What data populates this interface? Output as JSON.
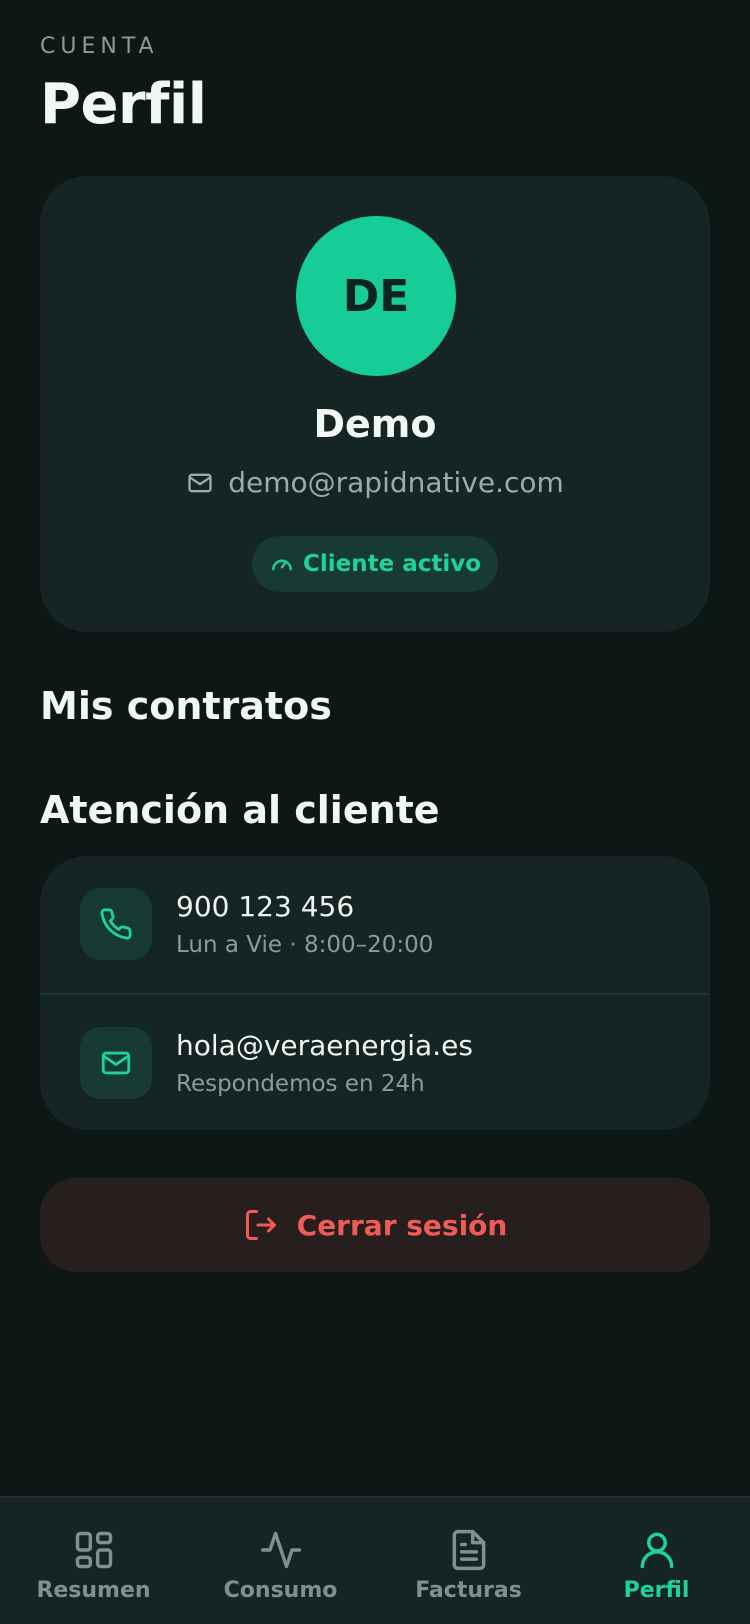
{
  "header": {
    "eyebrow": "CUENTA",
    "title": "Perfil"
  },
  "profile": {
    "initials": "DE",
    "name": "Demo",
    "email": "demo@rapidnative.com",
    "status": "Cliente activo"
  },
  "sections": {
    "contracts_title": "Mis contratos",
    "support_title": "Atención al cliente"
  },
  "support": [
    {
      "icon": "phone-icon",
      "primary": "900 123 456",
      "secondary": "Lun a Vie · 8:00–20:00"
    },
    {
      "icon": "mail-icon",
      "primary": "hola@veraenergia.es",
      "secondary": "Respondemos en 24h"
    }
  ],
  "logout": {
    "label": "Cerrar sesión",
    "icon": "logout-icon"
  },
  "tabs": [
    {
      "label": "Resumen",
      "icon": "grid-icon",
      "active": false
    },
    {
      "label": "Consumo",
      "icon": "activity-icon",
      "active": false
    },
    {
      "label": "Facturas",
      "icon": "document-icon",
      "active": false
    },
    {
      "label": "Perfil",
      "icon": "user-icon",
      "active": true
    }
  ],
  "colors": {
    "background": "#0c1716",
    "card": "#142523",
    "accent": "#1fd19c",
    "avatar": "#17cc97",
    "danger": "#ef5b57",
    "muted": "#8a9b98"
  }
}
